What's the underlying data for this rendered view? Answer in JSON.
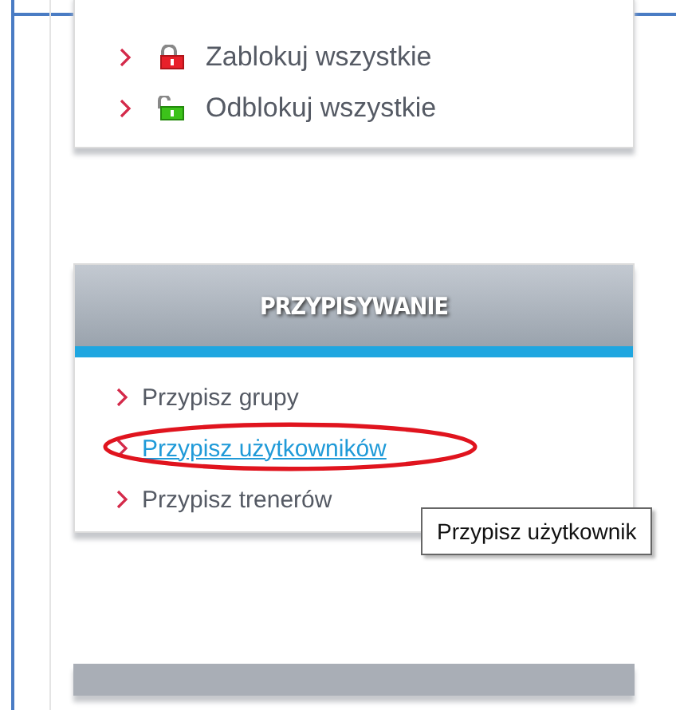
{
  "top_menu": {
    "items": [
      {
        "label": "Zablokuj wszystkie",
        "kind": "locked"
      },
      {
        "label": "Odblokuj wszystkie",
        "kind": "unlocked"
      }
    ]
  },
  "assign_panel": {
    "title": "PRZYPISYWANIE",
    "items": [
      {
        "label": "Przypisz grupy",
        "hovered": false,
        "circled": false
      },
      {
        "label": "Przypisz użytkowników",
        "hovered": true,
        "circled": true
      },
      {
        "label": "Przypisz trenerów",
        "hovered": false,
        "circled": false
      }
    ]
  },
  "tooltip": {
    "text": "Przypisz użytkownik"
  }
}
